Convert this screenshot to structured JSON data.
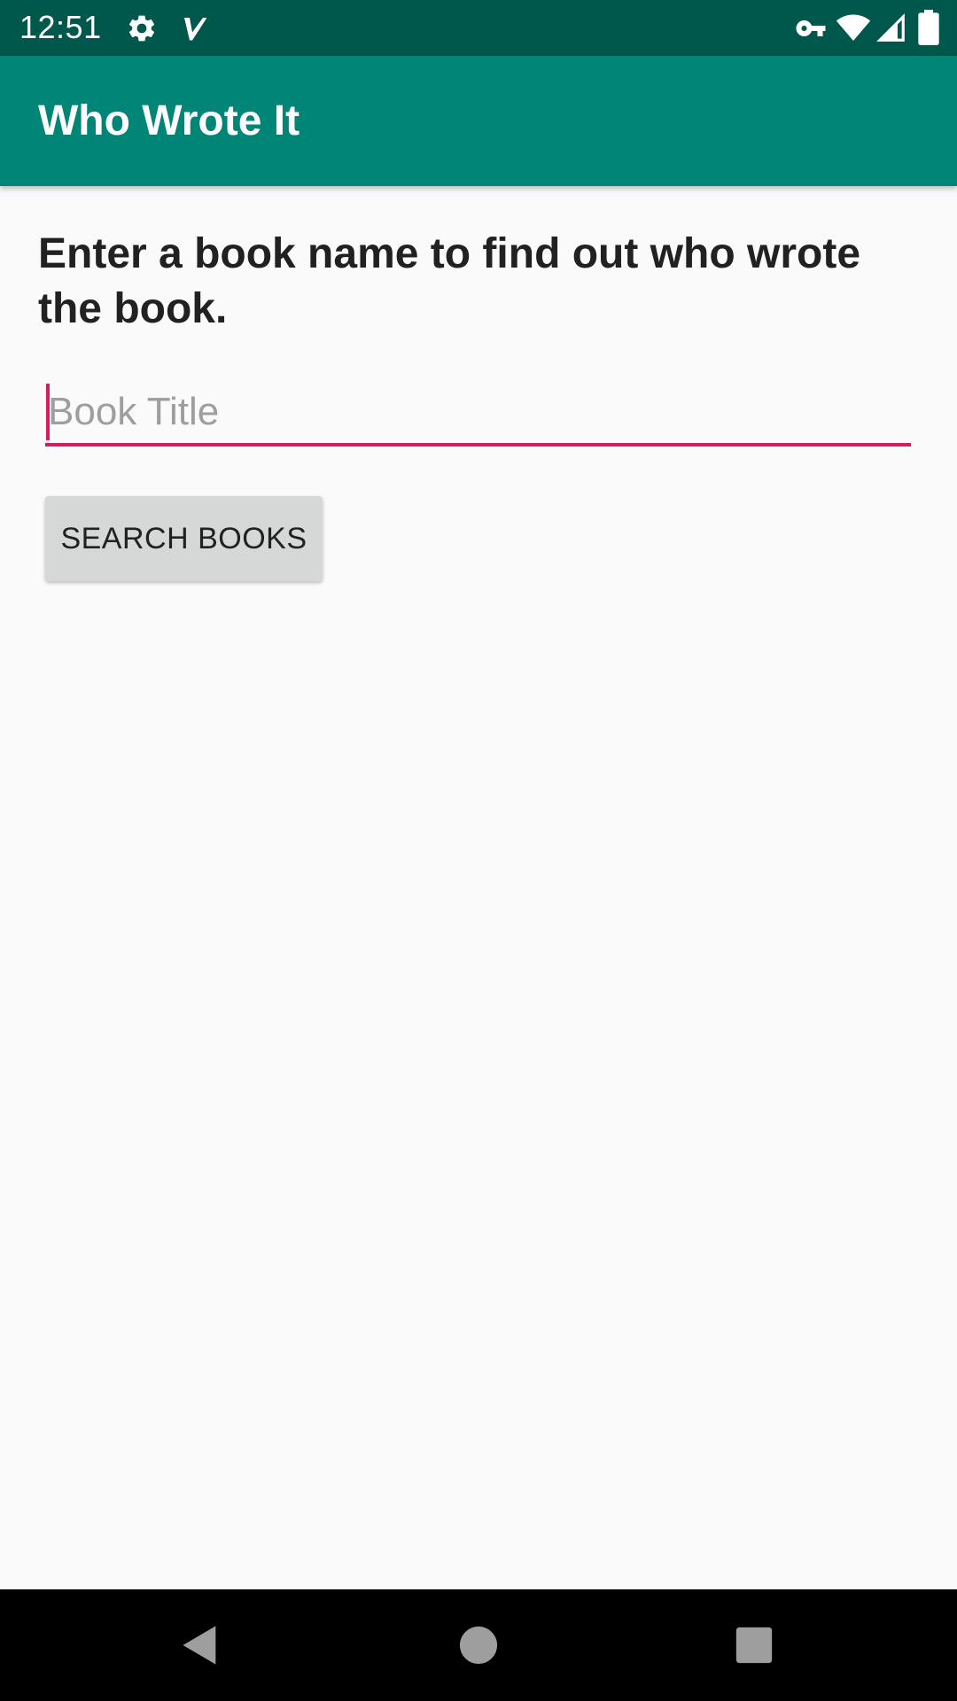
{
  "status_bar": {
    "time": "12:51",
    "icons": [
      "gear-icon",
      "check-icon",
      "vpn-key-icon",
      "wifi-icon",
      "signal-icon",
      "battery-icon"
    ]
  },
  "app_bar": {
    "title": "Who Wrote It",
    "color": "#008577"
  },
  "main": {
    "prompt": "Enter a book name to find out who wrote the book.",
    "book_input": {
      "placeholder": "Book Title",
      "value": ""
    },
    "search_button_label": "SEARCH BOOKS"
  },
  "colors": {
    "status_bar": "#00574b",
    "app_bar": "#008577",
    "accent": "#d81b60",
    "button": "#d6d7d7",
    "background": "#fafafa"
  },
  "nav_bar": {
    "icons": [
      "back-icon",
      "home-icon",
      "recents-icon"
    ]
  }
}
